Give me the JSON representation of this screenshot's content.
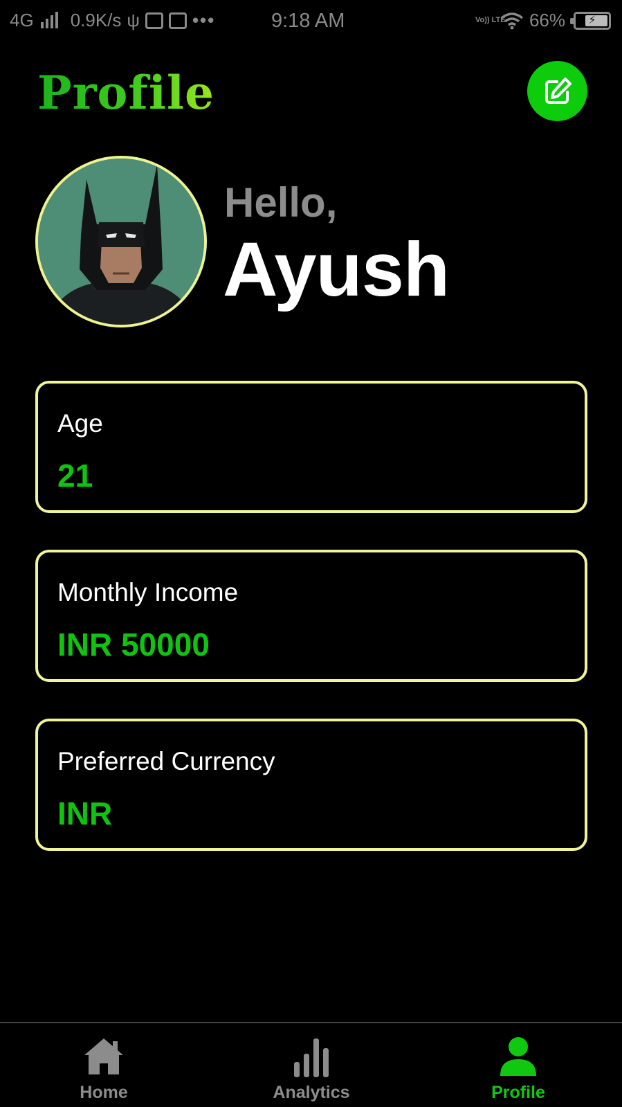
{
  "status_bar": {
    "network": "4G",
    "speed": "0.9K/s",
    "time": "9:18 AM",
    "volte": "Vo)) LTE",
    "battery": "66%"
  },
  "header": {
    "title": "Profile",
    "edit_icon": "edit-pencil-icon"
  },
  "greeting": {
    "hello": "Hello,",
    "name": "Ayush"
  },
  "cards": [
    {
      "label": "Age",
      "value": "21"
    },
    {
      "label": "Monthly Income",
      "value": "INR 50000"
    },
    {
      "label": "Preferred Currency",
      "value": "INR"
    }
  ],
  "nav": {
    "items": [
      {
        "label": "Home",
        "icon": "home-icon",
        "active": false
      },
      {
        "label": "Analytics",
        "icon": "analytics-icon",
        "active": false
      },
      {
        "label": "Profile",
        "icon": "profile-icon",
        "active": true
      }
    ]
  },
  "colors": {
    "accent": "#0ccc0c",
    "card_border": "#f0f49b",
    "value_text": "#0fc40f",
    "muted": "#8c8c8c"
  }
}
